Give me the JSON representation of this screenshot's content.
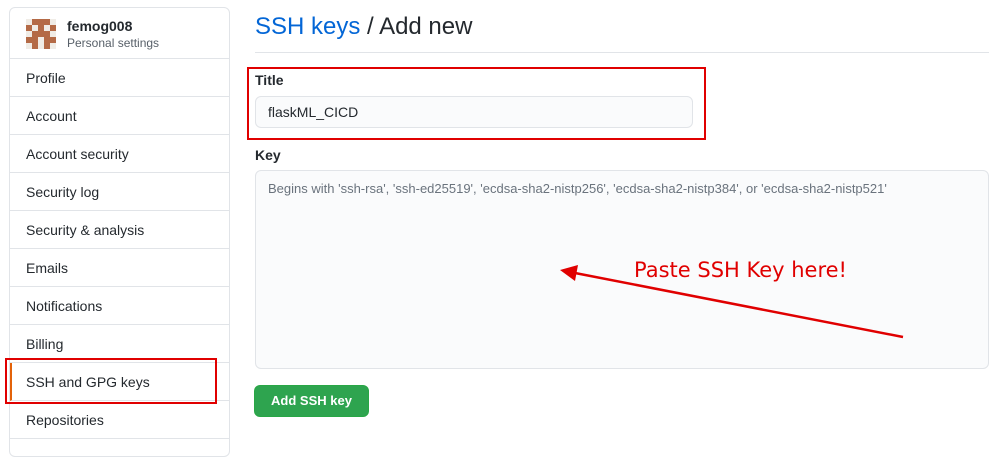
{
  "sidebar": {
    "username": "femog008",
    "subtitle": "Personal settings",
    "items": [
      {
        "label": "Profile"
      },
      {
        "label": "Account"
      },
      {
        "label": "Account security"
      },
      {
        "label": "Security log"
      },
      {
        "label": "Security & analysis"
      },
      {
        "label": "Emails"
      },
      {
        "label": "Notifications"
      },
      {
        "label": "Billing"
      },
      {
        "label": "SSH and GPG keys"
      },
      {
        "label": "Repositories"
      }
    ],
    "active_item": "SSH and GPG keys"
  },
  "header": {
    "crumb": "SSH keys",
    "separator": " / ",
    "title": "Add new"
  },
  "form": {
    "title_label": "Title",
    "title_value": "flaskML_CICD",
    "key_label": "Key",
    "key_placeholder": "Begins with 'ssh-rsa', 'ssh-ed25519', 'ecdsa-sha2-nistp256', 'ecdsa-sha2-nistp384', or 'ecdsa-sha2-nistp521'",
    "submit_label": "Add SSH key"
  },
  "annotation": {
    "text": "Paste SSH Key here!",
    "color": "#e00000"
  },
  "colors": {
    "link": "#0366d6",
    "button": "#2ea44f",
    "annotation": "#e00000"
  }
}
